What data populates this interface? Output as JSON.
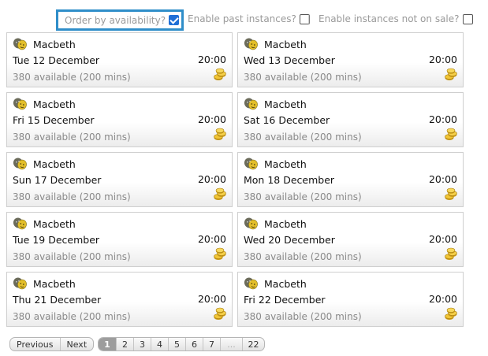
{
  "options": {
    "order_by_availability": {
      "label": "Order by availability?",
      "checked": true
    },
    "enable_past_instances": {
      "label": "Enable past instances?",
      "checked": false
    },
    "separator": "|",
    "enable_not_on_sale": {
      "label": "Enable instances not on sale?",
      "checked": false
    }
  },
  "performances": [
    {
      "title": "Macbeth",
      "date": "Tue 12 December",
      "time": "20:00",
      "availability": "380 available (200 mins)"
    },
    {
      "title": "Macbeth",
      "date": "Wed 13 December",
      "time": "20:00",
      "availability": "380 available (200 mins)"
    },
    {
      "title": "Macbeth",
      "date": "Fri 15 December",
      "time": "20:00",
      "availability": "380 available (200 mins)"
    },
    {
      "title": "Macbeth",
      "date": "Sat 16 December",
      "time": "20:00",
      "availability": "380 available (200 mins)"
    },
    {
      "title": "Macbeth",
      "date": "Sun 17 December",
      "time": "20:00",
      "availability": "380 available (200 mins)"
    },
    {
      "title": "Macbeth",
      "date": "Mon 18 December",
      "time": "20:00",
      "availability": "380 available (200 mins)"
    },
    {
      "title": "Macbeth",
      "date": "Tue 19 December",
      "time": "20:00",
      "availability": "380 available (200 mins)"
    },
    {
      "title": "Macbeth",
      "date": "Wed 20 December",
      "time": "20:00",
      "availability": "380 available (200 mins)"
    },
    {
      "title": "Macbeth",
      "date": "Thu 21 December",
      "time": "20:00",
      "availability": "380 available (200 mins)"
    },
    {
      "title": "Macbeth",
      "date": "Fri 22 December",
      "time": "20:00",
      "availability": "380 available (200 mins)"
    }
  ],
  "icons": {
    "performance": "theatre-masks-icon",
    "price": "gold-coins-icon"
  },
  "pagination": {
    "previous_label": "Previous",
    "next_label": "Next",
    "pages": [
      "1",
      "2",
      "3",
      "4",
      "5",
      "6",
      "7",
      "...",
      "22"
    ],
    "current": "1"
  },
  "colors": {
    "highlight_border": "#2f8ec9",
    "checkbox_checked": "#1f6fd6",
    "current_page": "#9d9d9d"
  }
}
